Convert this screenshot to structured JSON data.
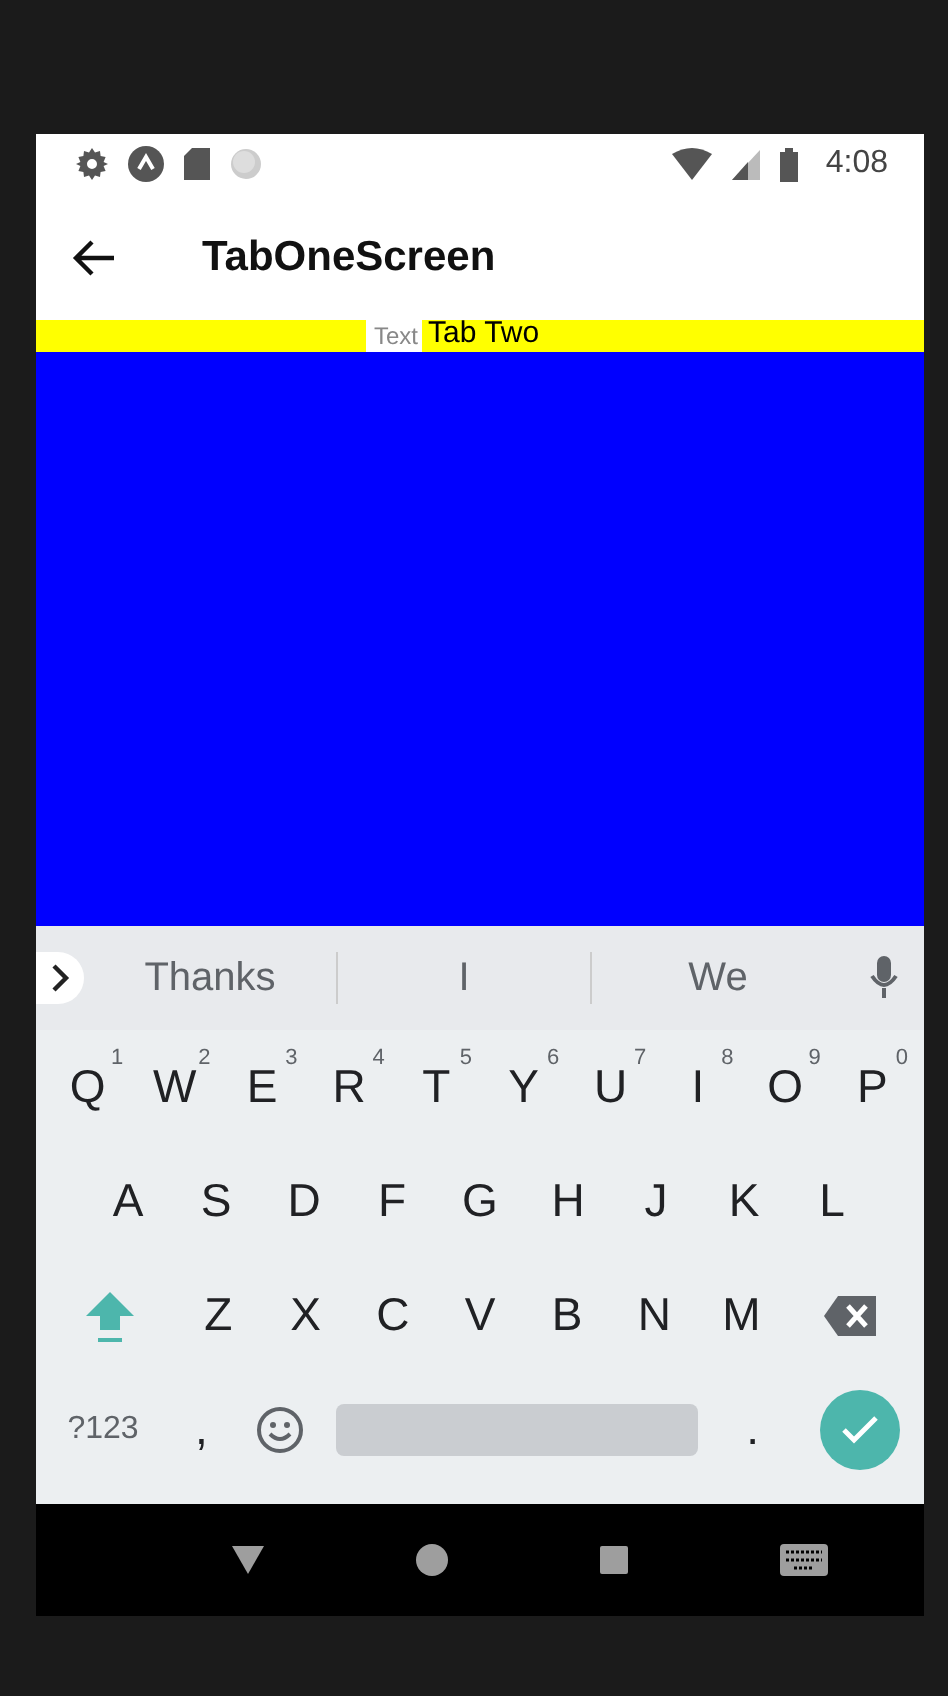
{
  "status_bar": {
    "time": "4:08"
  },
  "app_bar": {
    "title": "TabOneScreen"
  },
  "tab_strip": {
    "text_field": {
      "placeholder": "Text"
    },
    "label": "Tab Two"
  },
  "keyboard": {
    "suggestions": [
      "Thanks",
      "I",
      "We"
    ],
    "rows": [
      [
        {
          "kind": "letter",
          "label": "Q",
          "hint": "1"
        },
        {
          "kind": "letter",
          "label": "W",
          "hint": "2"
        },
        {
          "kind": "letter",
          "label": "E",
          "hint": "3"
        },
        {
          "kind": "letter",
          "label": "R",
          "hint": "4"
        },
        {
          "kind": "letter",
          "label": "T",
          "hint": "5"
        },
        {
          "kind": "letter",
          "label": "Y",
          "hint": "6"
        },
        {
          "kind": "letter",
          "label": "U",
          "hint": "7"
        },
        {
          "kind": "letter",
          "label": "I",
          "hint": "8"
        },
        {
          "kind": "letter",
          "label": "O",
          "hint": "9"
        },
        {
          "kind": "letter",
          "label": "P",
          "hint": "0"
        }
      ],
      [
        {
          "kind": "letter",
          "label": "A"
        },
        {
          "kind": "letter",
          "label": "S"
        },
        {
          "kind": "letter",
          "label": "D"
        },
        {
          "kind": "letter",
          "label": "F"
        },
        {
          "kind": "letter",
          "label": "G"
        },
        {
          "kind": "letter",
          "label": "H"
        },
        {
          "kind": "letter",
          "label": "J"
        },
        {
          "kind": "letter",
          "label": "K"
        },
        {
          "kind": "letter",
          "label": "L"
        }
      ],
      [
        {
          "kind": "shift"
        },
        {
          "kind": "letter",
          "label": "Z"
        },
        {
          "kind": "letter",
          "label": "X"
        },
        {
          "kind": "letter",
          "label": "C"
        },
        {
          "kind": "letter",
          "label": "V"
        },
        {
          "kind": "letter",
          "label": "B"
        },
        {
          "kind": "letter",
          "label": "N"
        },
        {
          "kind": "letter",
          "label": "M"
        },
        {
          "kind": "backspace"
        }
      ]
    ],
    "bottom_row": {
      "symbols_key": "?123",
      "comma_key": ",",
      "period_key": "."
    }
  }
}
